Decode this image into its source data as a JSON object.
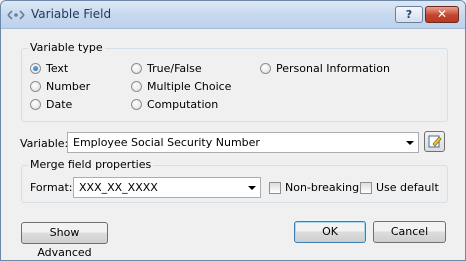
{
  "window": {
    "title": "Variable Field",
    "help_label": "?",
    "close_label": "✕"
  },
  "variable_type": {
    "label": "Variable type",
    "options": [
      "Text",
      "Number",
      "Date",
      "True/False",
      "Multiple Choice",
      "Computation",
      "Personal Information"
    ],
    "selected": "Text"
  },
  "variable": {
    "label": "Variable:",
    "value": "Employee Social Security Number"
  },
  "merge": {
    "label": "Merge field properties",
    "format_label": "Format:",
    "format_value": "XXX_XX_XXXX",
    "non_breaking_label": "Non-breaking",
    "use_default_label": "Use default"
  },
  "buttons": {
    "show_advanced": "Show Advanced",
    "ok": "OK",
    "cancel": "Cancel"
  },
  "colors": {
    "accent": "#3c7fb1",
    "close": "#c4442d"
  }
}
